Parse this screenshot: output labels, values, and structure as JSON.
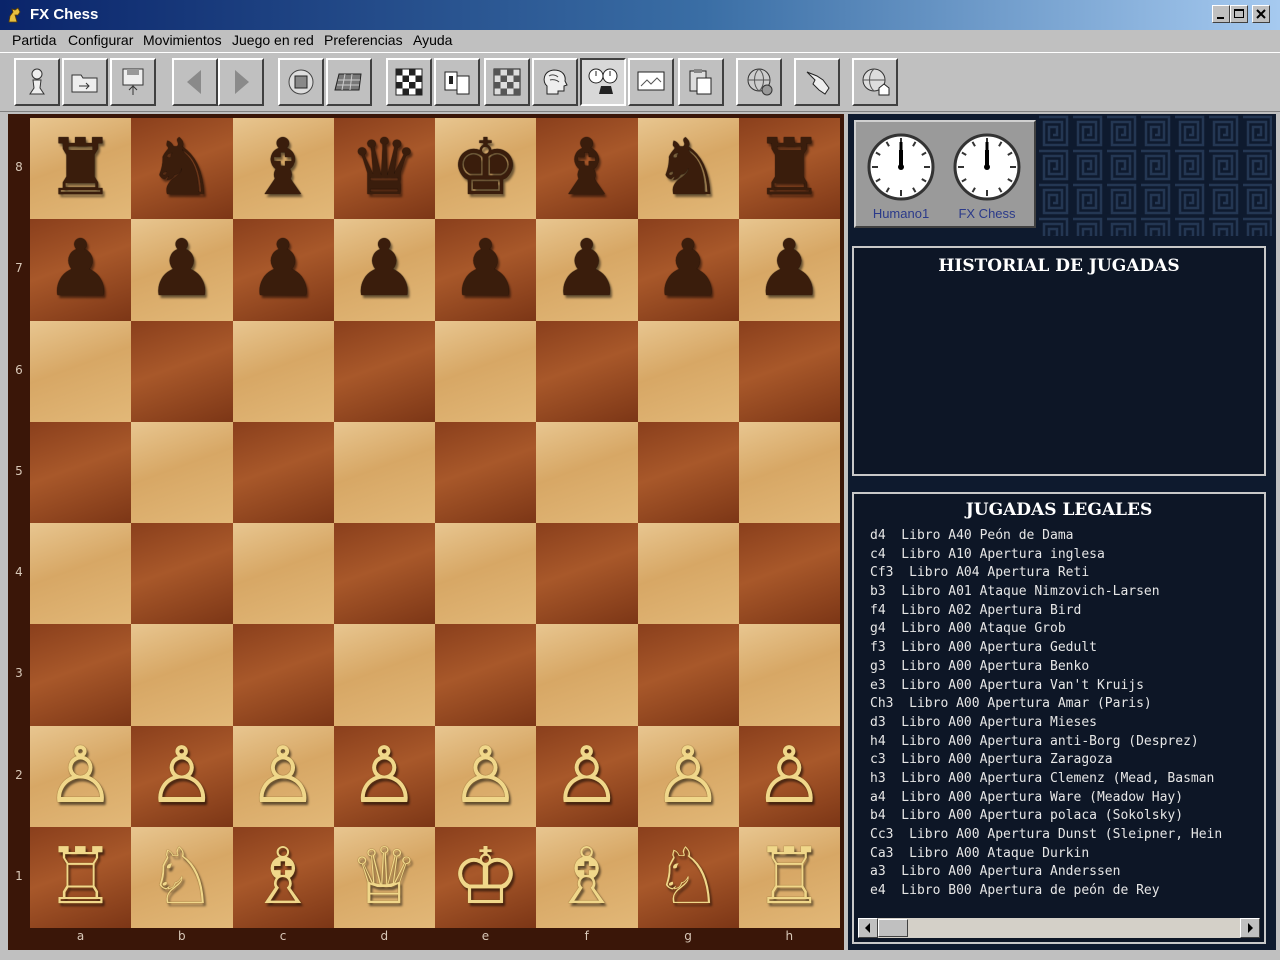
{
  "window": {
    "title": "FX Chess"
  },
  "menu": [
    "Partida",
    "Configurar",
    "Movimientos",
    "Juego en red",
    "Preferencias",
    "Ayuda"
  ],
  "toolbar": [
    {
      "name": "pawn-piece-icon",
      "pressed": false
    },
    {
      "name": "open-folder-icon",
      "pressed": false
    },
    {
      "name": "save-disk-icon",
      "pressed": false
    },
    {
      "name": "back-arrow-icon",
      "pressed": false
    },
    {
      "name": "forward-arrow-icon",
      "pressed": false
    },
    {
      "name": "setup-board-icon",
      "pressed": false
    },
    {
      "name": "board-3d-icon",
      "pressed": false
    },
    {
      "name": "board-2d-icon",
      "pressed": false
    },
    {
      "name": "copy-pages-icon",
      "pressed": false
    },
    {
      "name": "flip-board-icon",
      "pressed": false
    },
    {
      "name": "brain-head-icon",
      "pressed": false
    },
    {
      "name": "clocks-icon",
      "pressed": true
    },
    {
      "name": "screen-icon",
      "pressed": false
    },
    {
      "name": "clipboard-icon",
      "pressed": false
    },
    {
      "name": "network-globe-icon",
      "pressed": false
    },
    {
      "name": "pointing-hand-icon",
      "pressed": false
    },
    {
      "name": "web-home-icon",
      "pressed": false
    }
  ],
  "board": {
    "ranks": [
      "8",
      "7",
      "6",
      "5",
      "4",
      "3",
      "2",
      "1"
    ],
    "files": [
      "a",
      "b",
      "c",
      "d",
      "e",
      "f",
      "g",
      "h"
    ],
    "position": [
      [
        "br",
        "bn",
        "bb",
        "bq",
        "bk",
        "bb",
        "bn",
        "br"
      ],
      [
        "bp",
        "bp",
        "bp",
        "bp",
        "bp",
        "bp",
        "bp",
        "bp"
      ],
      [
        "",
        "",
        "",
        "",
        "",
        "",
        "",
        ""
      ],
      [
        "",
        "",
        "",
        "",
        "",
        "",
        "",
        ""
      ],
      [
        "",
        "",
        "",
        "",
        "",
        "",
        "",
        ""
      ],
      [
        "",
        "",
        "",
        "",
        "",
        "",
        "",
        ""
      ],
      [
        "wp",
        "wp",
        "wp",
        "wp",
        "wp",
        "wp",
        "wp",
        "wp"
      ],
      [
        "wr",
        "wn",
        "wb",
        "wq",
        "wk",
        "wb",
        "wn",
        "wr"
      ]
    ]
  },
  "clocks": [
    {
      "player": "Humano1",
      "time_label": "12:00"
    },
    {
      "player": "FX Chess",
      "time_label": "12:00"
    }
  ],
  "history": {
    "title": "HISTORIAL DE JUGADAS",
    "moves": []
  },
  "legal_moves": {
    "title": "JUGADAS LEGALES",
    "items": [
      "d4  Libro A40 Peón de Dama",
      "c4  Libro A10 Apertura inglesa",
      "Cf3  Libro A04 Apertura Reti",
      "b3  Libro A01 Ataque Nimzovich-Larsen",
      "f4  Libro A02 Apertura Bird",
      "g4  Libro A00 Ataque Grob",
      "f3  Libro A00 Apertura Gedult",
      "g3  Libro A00 Apertura Benko",
      "e3  Libro A00 Apertura Van't Kruijs",
      "Ch3  Libro A00 Apertura Amar (Paris)",
      "d3  Libro A00 Apertura Mieses",
      "h4  Libro A00 Apertura anti-Borg (Desprez)",
      "c3  Libro A00 Apertura Zaragoza",
      "h3  Libro A00 Apertura Clemenz (Mead, Basman",
      "a4  Libro A00 Apertura Ware (Meadow Hay)",
      "b4  Libro A00 Apertura polaca (Sokolsky)",
      "Cc3  Libro A00 Apertura Dunst (Sleipner, Hein",
      "Ca3  Libro A00 Ataque Durkin",
      "a3  Libro A00 Apertura Anderssen",
      "e4  Libro B00 Apertura de peón de Rey"
    ]
  }
}
